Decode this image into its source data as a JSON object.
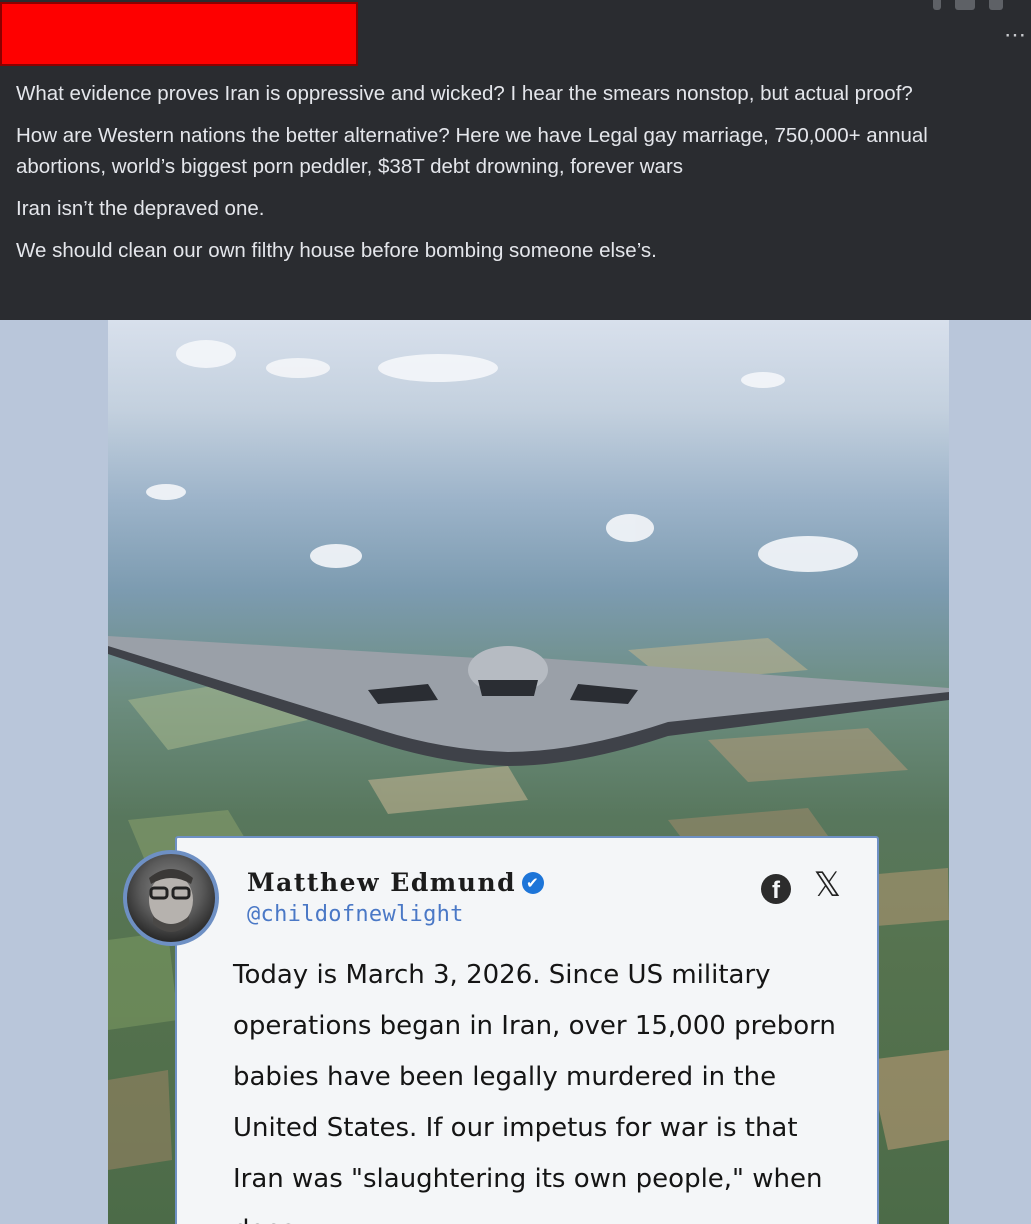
{
  "post": {
    "paragraphs": [
      "What evidence proves Iran is oppressive and wicked? I hear the smears nonstop, but actual proof?",
      "How are Western nations the better alternative? Here we have Legal gay marriage, 750,000+ annual abortions, world’s biggest porn peddler, $38T debt drowning, forever wars",
      "Iran isn’t the depraved one.",
      "We should clean our own filthy house before bombing someone else’s."
    ],
    "more_menu_label": "⋯",
    "redaction_color": "#fe0000"
  },
  "image": {
    "subject_icon": "stealth-bomber-aircraft",
    "tweet": {
      "author_name": "Matthew Edmund",
      "verified_badge": "✔",
      "handle": "@childofnewlight",
      "platform_icons": [
        "facebook-icon",
        "x-icon"
      ],
      "facebook_glyph": "f",
      "x_glyph": "𝕏",
      "body": "Today is March 3, 2026. Since US military operations began in Iran, over 15,000 preborn babies have been legally murdered in the United States. If our impetus for war is that Iran was \"slaughtering its own people,\" when does"
    }
  }
}
